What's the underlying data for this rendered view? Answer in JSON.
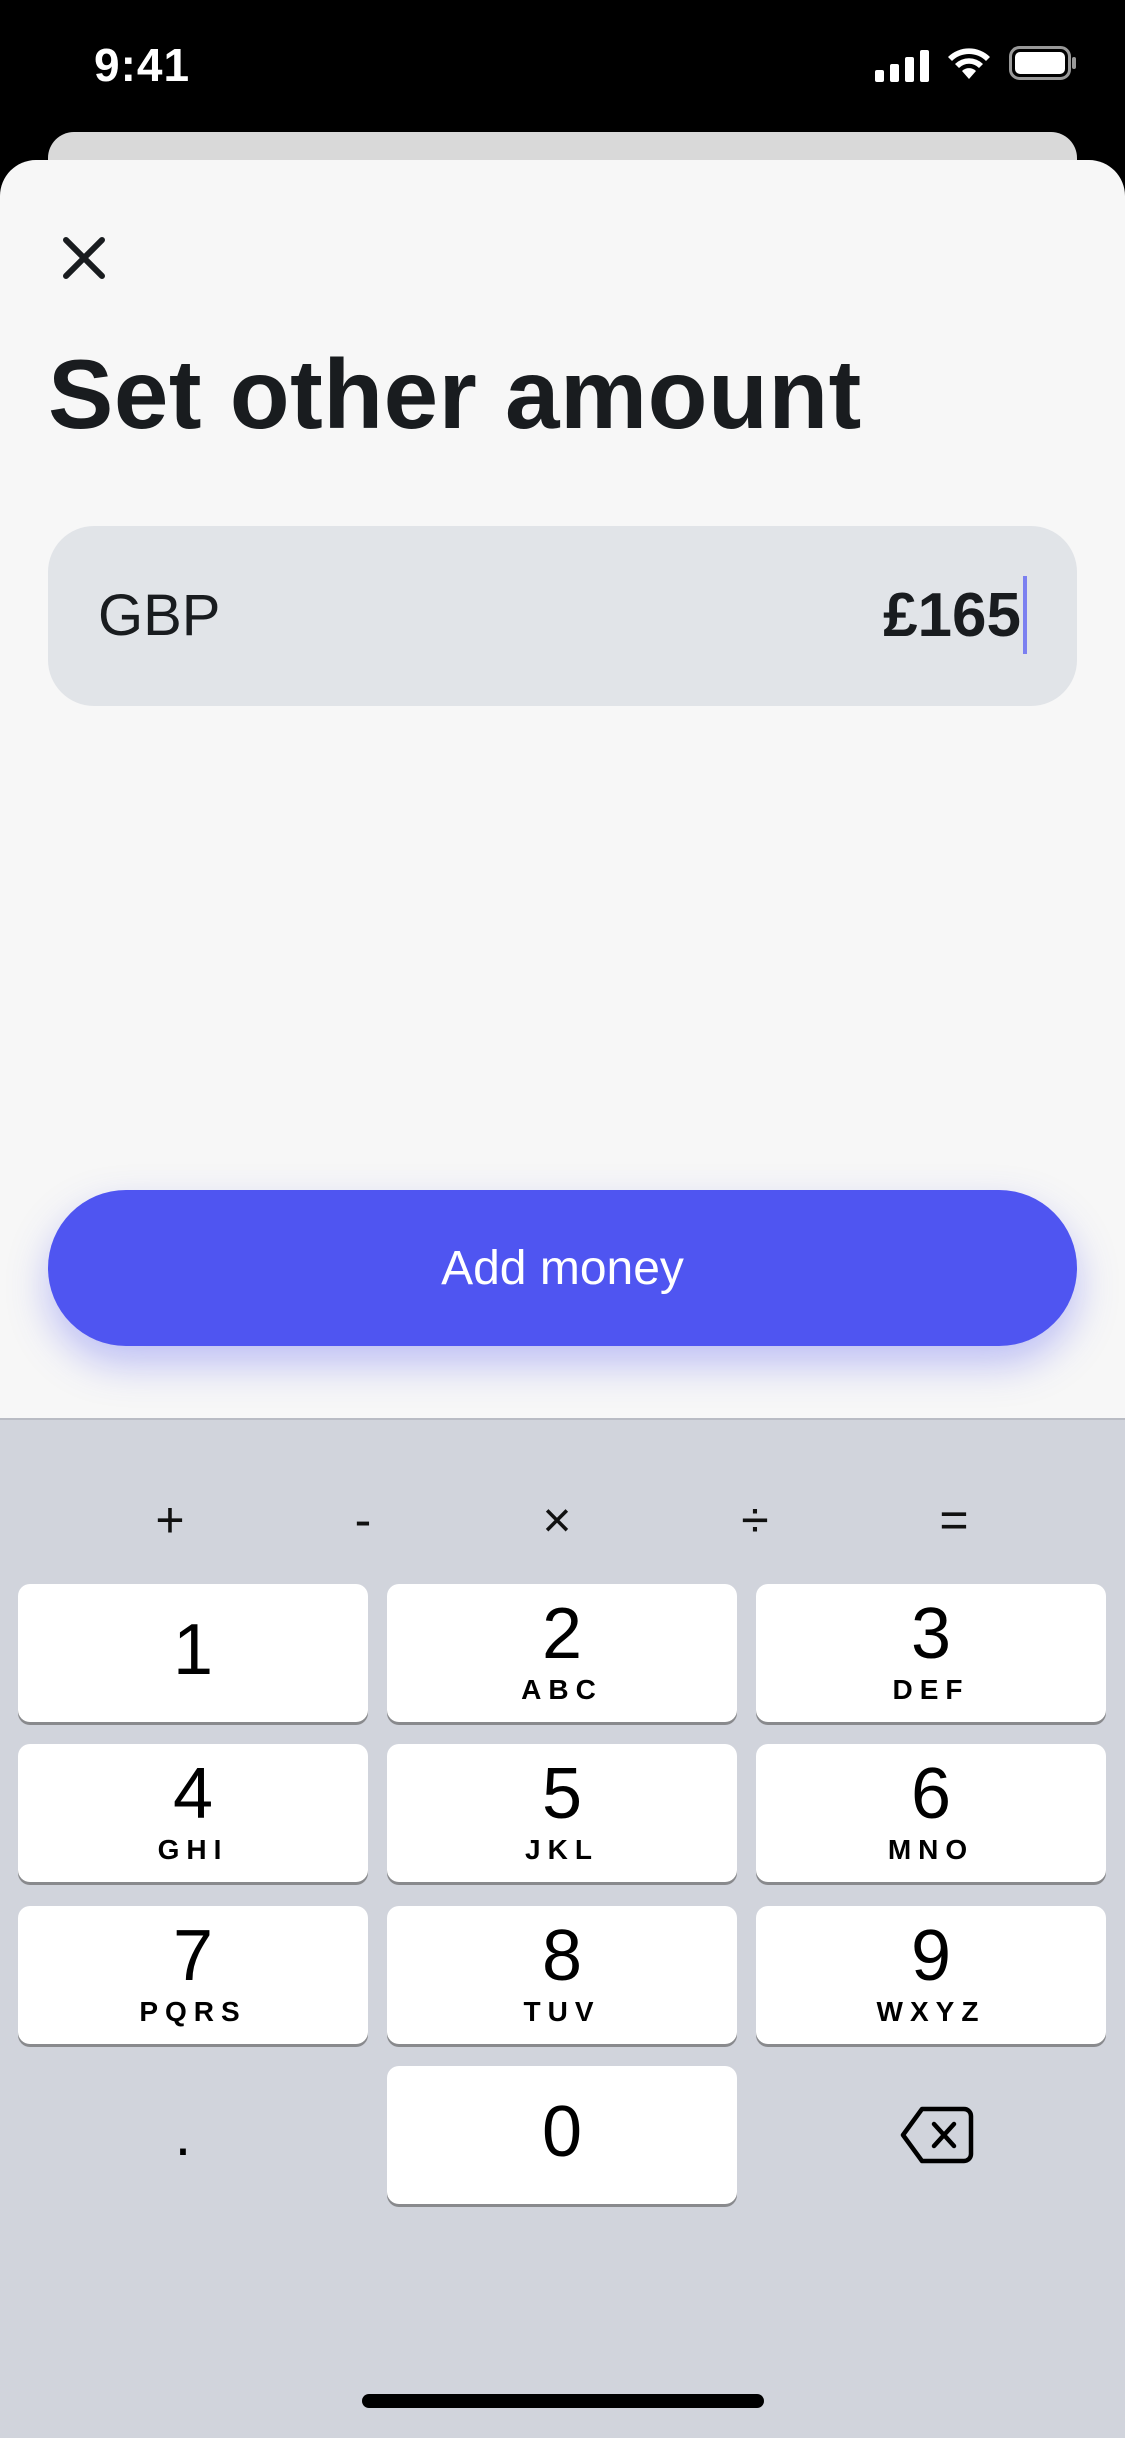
{
  "status_bar": {
    "time": "9:41"
  },
  "sheet": {
    "title": "Set other amount",
    "amount_field": {
      "currency": "GBP",
      "value": "£165"
    },
    "add_money_label": "Add money"
  },
  "keyboard": {
    "operators": [
      "+",
      "-",
      "×",
      "÷",
      "="
    ],
    "keys": [
      {
        "digit": "1",
        "letters": ""
      },
      {
        "digit": "2",
        "letters": "ABC"
      },
      {
        "digit": "3",
        "letters": "DEF"
      },
      {
        "digit": "4",
        "letters": "GHI"
      },
      {
        "digit": "5",
        "letters": "JKL"
      },
      {
        "digit": "6",
        "letters": "MNO"
      },
      {
        "digit": "7",
        "letters": "PQRS"
      },
      {
        "digit": "8",
        "letters": "TUV"
      },
      {
        "digit": "9",
        "letters": "WXYZ"
      }
    ],
    "decimal": ".",
    "zero": "0"
  },
  "colors": {
    "accent": "#4f55f1",
    "field_background": "#e1e4e8",
    "sheet_background": "#f7f7f7",
    "keyboard_background": "#d1d4dc"
  },
  "icons": {
    "close": "close-icon",
    "backspace": "backspace-icon",
    "signal": "signal-icon",
    "wifi": "wifi-icon",
    "battery": "battery-icon"
  }
}
